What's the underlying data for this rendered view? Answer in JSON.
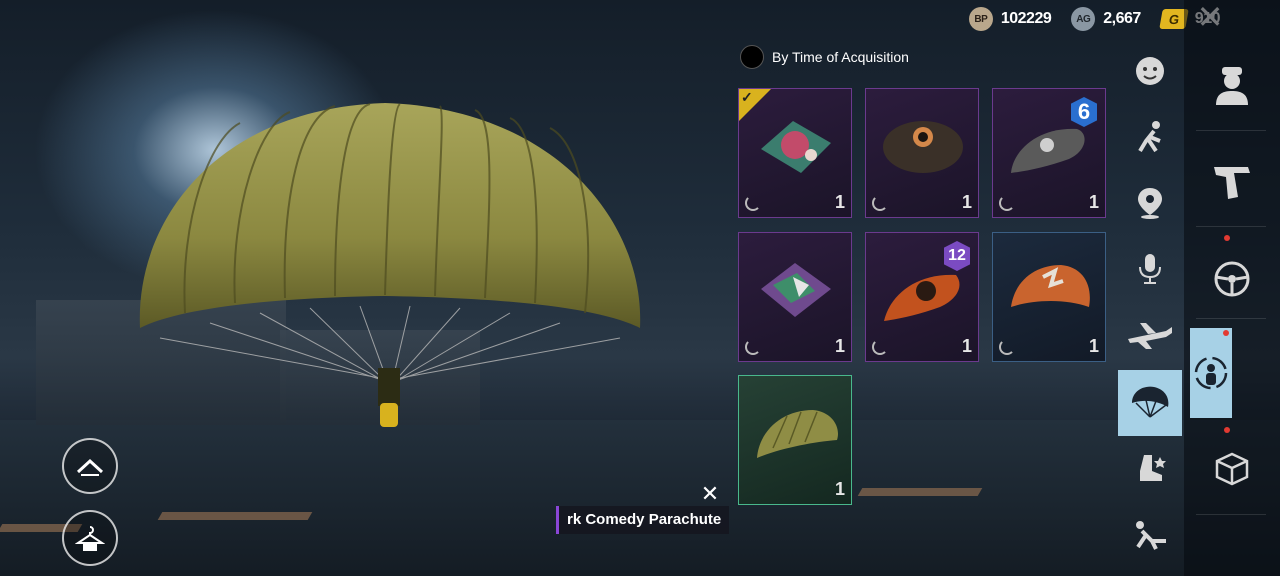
{
  "currencies": [
    {
      "icon": "bp-icon",
      "badge": "BP",
      "value": "102229"
    },
    {
      "icon": "ag-icon",
      "badge": "AG",
      "value": "2,667"
    },
    {
      "icon": "uc-icon",
      "badge": "G",
      "value": "910"
    }
  ],
  "close_label": "✕",
  "sort": {
    "label": "By Time of Acquisition"
  },
  "items": [
    {
      "name": "parachute-pink-camo",
      "count": "1",
      "equipped": true,
      "rarity": "purple",
      "colors": [
        "#3b7d6e",
        "#c24b6a"
      ]
    },
    {
      "name": "parachute-dark-skull",
      "count": "1",
      "rarity": "purple",
      "colors": [
        "#3a3028",
        "#d4884a"
      ]
    },
    {
      "name": "parachute-skull-pattern",
      "count": "1",
      "rarity": "purple",
      "badge": "6",
      "colors": [
        "#5a5a5a",
        "#2a2a2a"
      ]
    },
    {
      "name": "parachute-purple-graffiti",
      "count": "1",
      "rarity": "purple",
      "colors": [
        "#8a4fbf",
        "#3e8e6a"
      ]
    },
    {
      "name": "parachute-tiger",
      "count": "1",
      "rarity": "purple",
      "badge": "12",
      "colors": [
        "#c2521e",
        "#2a1a12"
      ]
    },
    {
      "name": "parachute-orange-white",
      "count": "1",
      "rarity": "blue",
      "colors": [
        "#c9642e",
        "#e6e1d8"
      ]
    },
    {
      "name": "parachute-olive",
      "count": "1",
      "rarity": "green",
      "colors": [
        "#8a8a3f",
        "#5a5a25"
      ]
    }
  ],
  "tooltip": {
    "text": "rk Comedy Parachute",
    "close": "✕"
  },
  "category_icons": [
    "emote-icon",
    "throw-icon",
    "location-icon",
    "voice-icon",
    "plane-icon",
    "parachute-icon",
    "footprint-icon",
    "pose-icon"
  ],
  "right_icons": [
    "character-icon",
    "gun-icon",
    "steering-wheel-icon",
    "outfit-icon",
    "crate-icon"
  ],
  "colors": {
    "accent": "#a7d1e6",
    "canopy": "#8f8d45",
    "gold": "#d9b21e"
  }
}
